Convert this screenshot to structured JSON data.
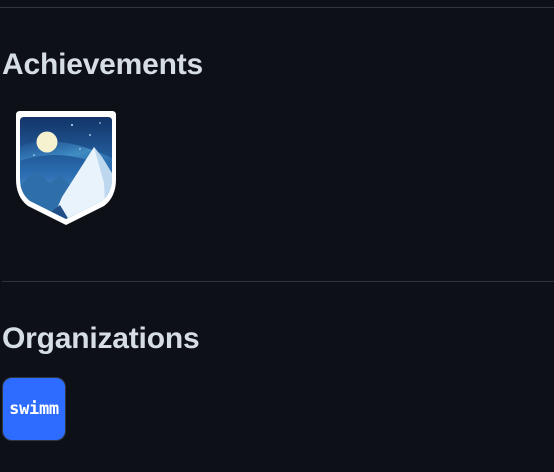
{
  "sections": {
    "achievements": {
      "title": "Achievements",
      "badges": [
        {
          "icon": "arctic-mountain-badge-icon"
        }
      ]
    },
    "organizations": {
      "title": "Organizations",
      "items": [
        {
          "avatar_text": "swimm",
          "avatar_color": "#2e6bff"
        }
      ]
    }
  },
  "colors": {
    "background": "#0d1117",
    "divider": "#30363d",
    "heading": "#d6dde4"
  }
}
